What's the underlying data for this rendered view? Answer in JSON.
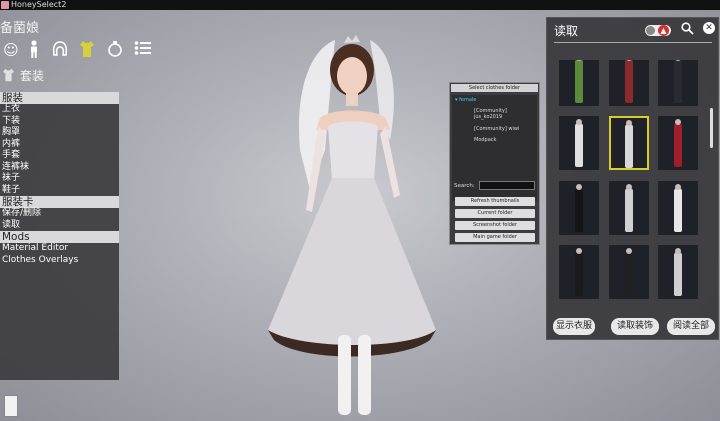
{
  "window": {
    "title": "HoneySelect2"
  },
  "header": {
    "name": "备菌娘"
  },
  "top_icons": [
    "face-icon",
    "body-icon",
    "hair-icon",
    "clothes-icon",
    "accessory-icon",
    "list-icon"
  ],
  "subheader": {
    "label": "套装"
  },
  "left_menu": {
    "sections": [
      {
        "title": "服装",
        "items": [
          "上衣",
          "下装",
          "胸罩",
          "内裤",
          "手套",
          "连裤袜",
          "袜子",
          "鞋子"
        ]
      },
      {
        "title": "服装卡",
        "items": [
          "保存/删除",
          "读取"
        ]
      },
      {
        "title": "Mods",
        "items": [
          "Material Editor",
          "Clothes Overlays"
        ]
      }
    ]
  },
  "folder_panel": {
    "title": "Select clothes folder",
    "tree": [
      "female",
      "[Community] jus_ko2019",
      "[Community] wiwi",
      "Modpack"
    ],
    "search_label": "Search:",
    "search_value": "",
    "buttons": [
      "Refresh thumbnails",
      "Current folder",
      "Screenshot folder",
      "Main game folder"
    ]
  },
  "right_panel": {
    "title": "读取",
    "buttons": [
      "显示衣服",
      "读取装饰",
      "阅读全部"
    ],
    "thumbnails": [
      {
        "color": "#5c8a3a",
        "selected": false
      },
      {
        "color": "#8a2a2a",
        "selected": false
      },
      {
        "color": "#2a2a33",
        "selected": false
      },
      {
        "color": "#e0e0e0",
        "selected": false
      },
      {
        "color": "#d8d8dc",
        "selected": true
      },
      {
        "color": "#a01e2a",
        "selected": false
      },
      {
        "color": "#151515",
        "selected": false
      },
      {
        "color": "#d0d0d0",
        "selected": false
      },
      {
        "color": "#e8e8e8",
        "selected": false
      },
      {
        "color": "#1a1a1a",
        "selected": false
      },
      {
        "color": "#202020",
        "selected": false
      },
      {
        "color": "#cfcfcf",
        "selected": false
      }
    ]
  },
  "colors": {
    "accent_selected": "#d6cf2a",
    "panel_bg": "#3a3a3e",
    "section_bg": "#d9d9dc"
  }
}
